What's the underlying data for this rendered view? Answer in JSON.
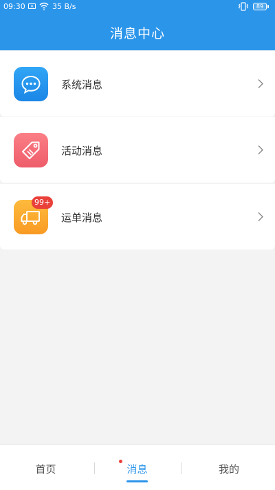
{
  "status_bar": {
    "time": "09:30",
    "sim_icon": "sim-icon",
    "network_speed": "35 B/s",
    "battery_level": "89"
  },
  "header": {
    "title": "消息中心"
  },
  "messages": [
    {
      "label": "系统消息",
      "icon": "chat-bubble-icon",
      "color": "#2196f3"
    },
    {
      "label": "活动消息",
      "icon": "tag-icon",
      "color": "#f0616d"
    },
    {
      "label": "运单消息",
      "icon": "truck-icon",
      "color": "#fba52e",
      "badge": "99+"
    }
  ],
  "nav": {
    "tabs": [
      {
        "label": "首页",
        "active": false
      },
      {
        "label": "消息",
        "active": true,
        "dot": true
      },
      {
        "label": "我的",
        "active": false
      }
    ]
  },
  "colors": {
    "primary": "#2b95ea",
    "badge": "#e9403a",
    "background": "#f3f3f3"
  }
}
